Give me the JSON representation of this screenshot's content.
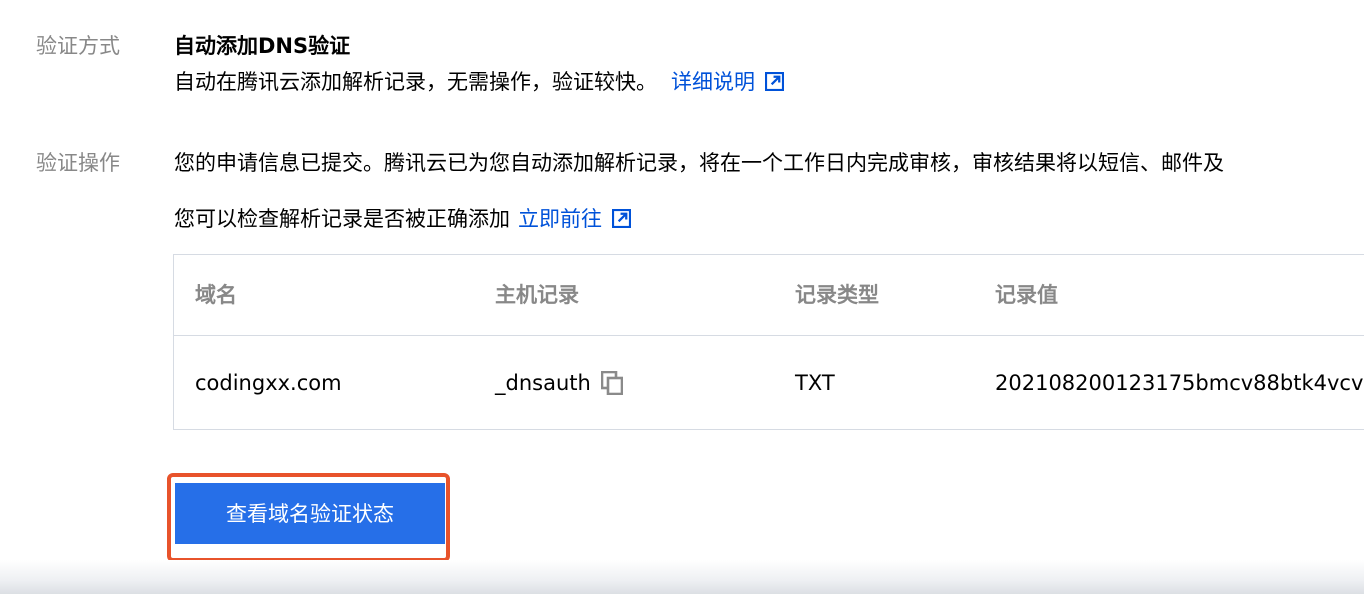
{
  "verification_method": {
    "label": "验证方式",
    "title": "自动添加DNS验证",
    "description": "自动在腾讯云添加解析记录，无需操作，验证较快。",
    "link_text": "详细说明",
    "link_icon": "external-link-icon"
  },
  "verification_action": {
    "label": "验证操作",
    "message": "您的申请信息已提交。腾讯云已为您自动添加解析记录，将在一个工作日内完成审核，审核结果将以短信、邮件及",
    "check_text": "您可以检查解析记录是否被正确添加",
    "link_text": "立即前往",
    "link_icon": "external-link-icon"
  },
  "table": {
    "headers": [
      "域名",
      "主机记录",
      "记录类型",
      "记录值"
    ],
    "rows": [
      {
        "domain": "codingxx.com",
        "host": "_dnsauth",
        "type": "TXT",
        "value": "20210820012317‌5bmcv88btk4vcv"
      }
    ],
    "copy_icon": "copy-icon"
  },
  "actions": {
    "check_status_label": "查看域名验证状态",
    "highlight_color": "#e8532b",
    "button_color": "#266fe8"
  },
  "colors": {
    "link": "#0052d9",
    "muted": "#888888",
    "border": "#d6dbe3"
  }
}
